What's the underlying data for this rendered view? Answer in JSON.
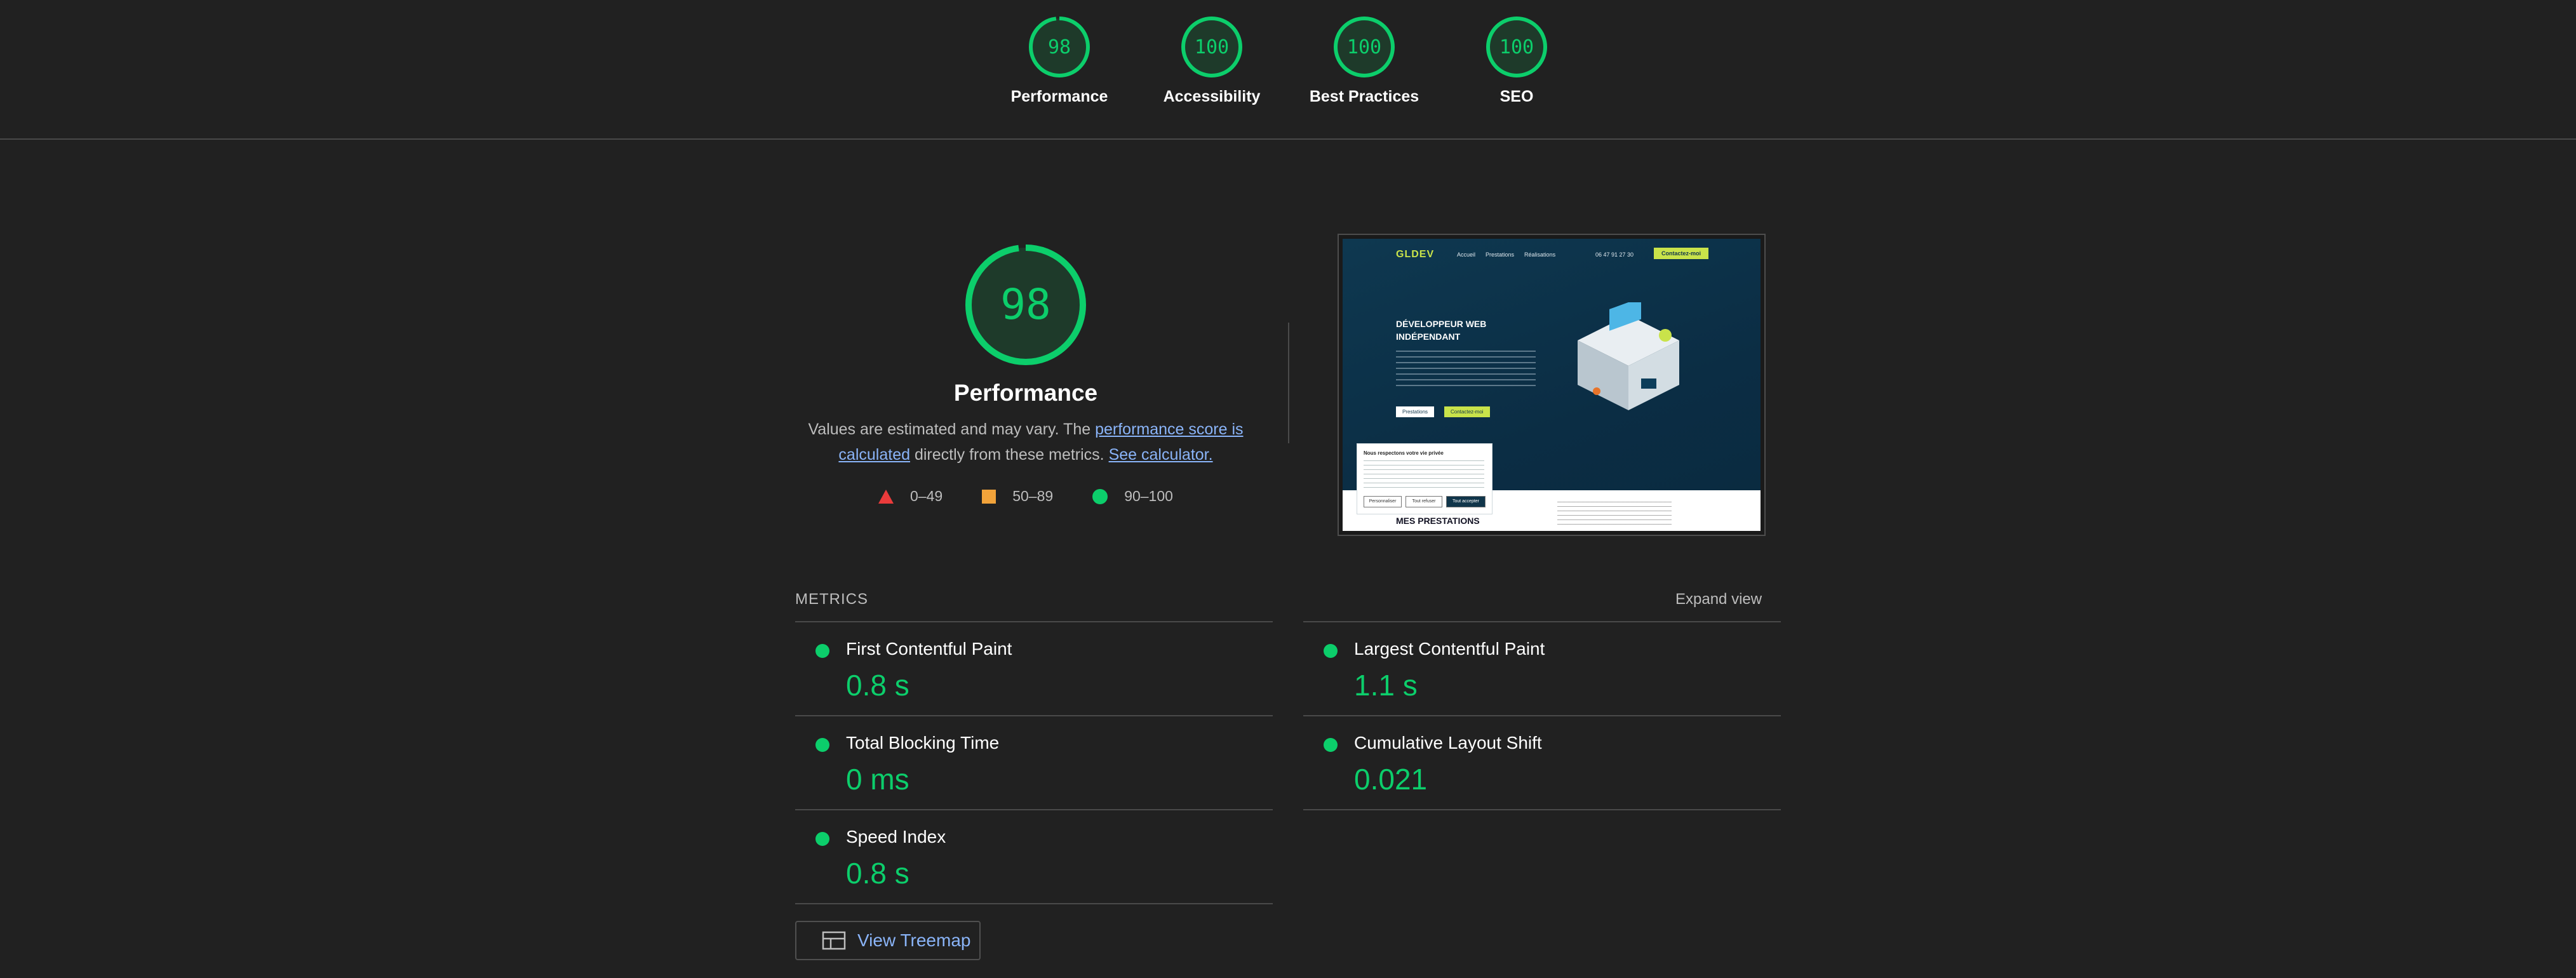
{
  "summary": [
    {
      "score": "98",
      "label": "Performance",
      "value": 0.98
    },
    {
      "score": "100",
      "label": "Accessibility",
      "value": 1.0
    },
    {
      "score": "100",
      "label": "Best Practices",
      "value": 1.0
    },
    {
      "score": "100",
      "label": "SEO",
      "value": 1.0
    }
  ],
  "performance": {
    "score": "98",
    "value": 0.98,
    "title": "Performance",
    "desc_1": "Values are estimated and may vary. The ",
    "link_score": "performance score is calculated",
    "desc_2": " directly from these metrics. ",
    "link_calc": "See calculator.",
    "legend": [
      "0–49",
      "50–89",
      "90–100"
    ]
  },
  "screenshot": {
    "logo": "GLDEV",
    "nav": [
      "Accueil",
      "Prestations",
      "Réalisations"
    ],
    "phone": "06 47 91 27 30",
    "cta": "Contactez-moi",
    "headline": "DÉVELOPPEUR WEB INDÉPENDANT",
    "btn_primary": "Prestations",
    "btn_secondary": "Contactez-moi",
    "cookie_title": "Nous respectons votre vie privée",
    "cookie_buttons": [
      "Personnaliser",
      "Tout refuser",
      "Tout accepter"
    ],
    "section_title": "MES PRESTATIONS"
  },
  "metrics": {
    "header": "METRICS",
    "expand": "Expand view",
    "items": [
      {
        "name": "First Contentful Paint",
        "value": "0.8 s"
      },
      {
        "name": "Largest Contentful Paint",
        "value": "1.1 s"
      },
      {
        "name": "Total Blocking Time",
        "value": "0 ms"
      },
      {
        "name": "Cumulative Layout Shift",
        "value": "0.021"
      },
      {
        "name": "Speed Index",
        "value": "0.8 s"
      }
    ]
  },
  "treemap": {
    "label": "View Treemap"
  },
  "colors": {
    "pass": "#0cce6b",
    "average": "#f2a33a",
    "fail": "#eb3b3b",
    "link": "#8ab4f8",
    "background": "#212121"
  }
}
